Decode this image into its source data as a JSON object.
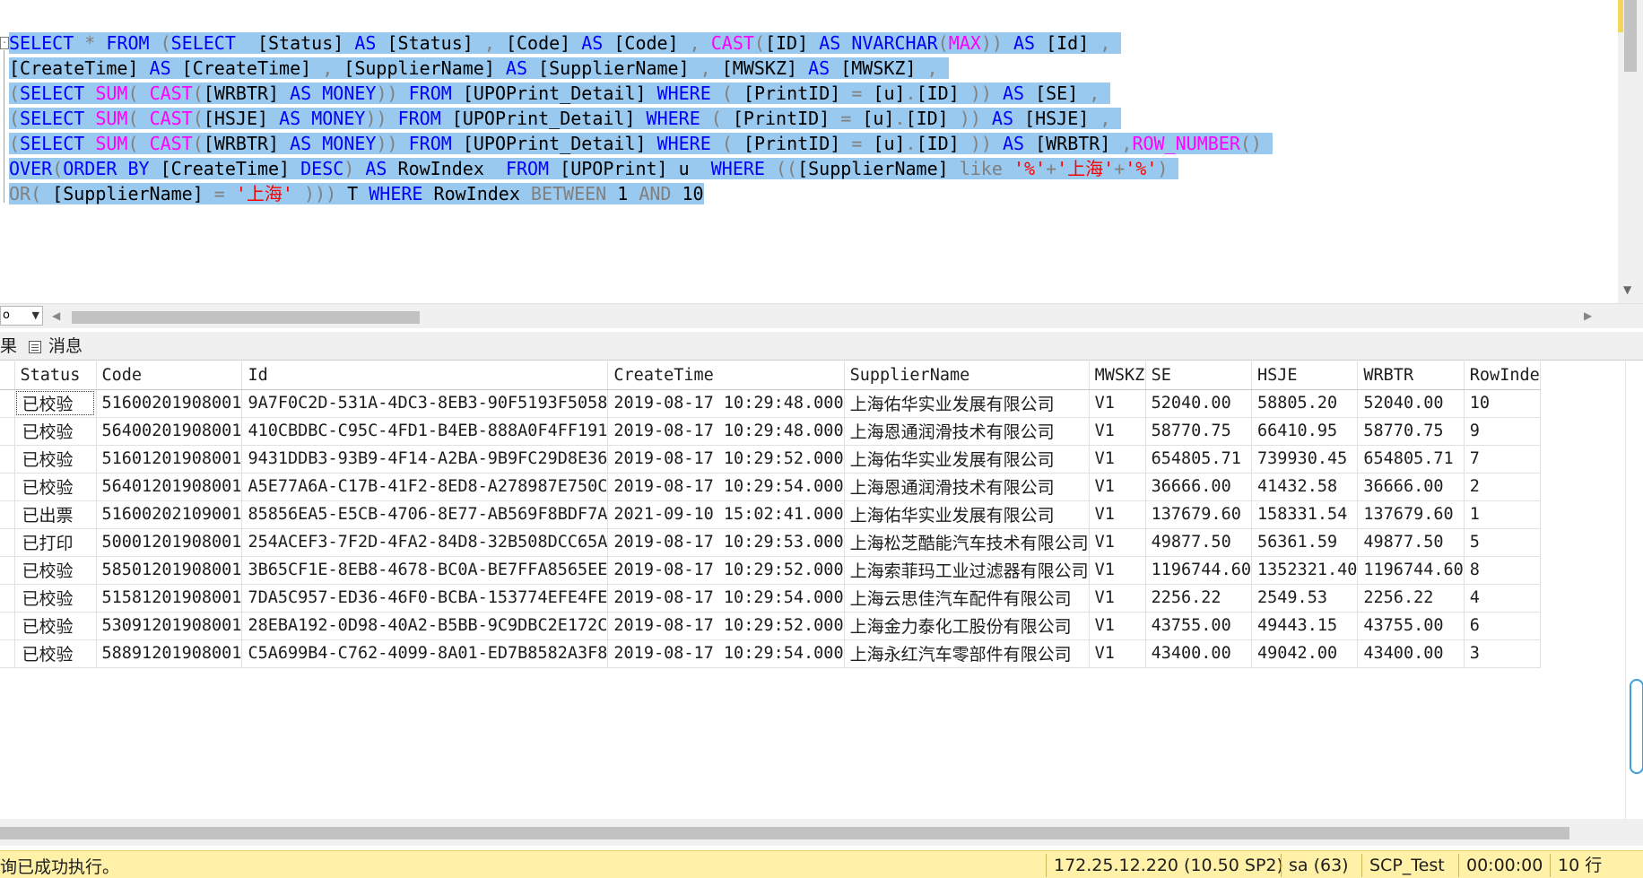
{
  "editor": {
    "fold_symbol": "-",
    "lines": [
      [
        [
          "kw",
          "SELECT"
        ],
        [
          "op",
          " * "
        ],
        [
          "kw",
          "FROM"
        ],
        [
          "tx",
          " "
        ],
        [
          "op",
          "("
        ],
        [
          "kw",
          "SELECT"
        ],
        [
          "tx",
          "  [Status] "
        ],
        [
          "kw",
          "AS"
        ],
        [
          "tx",
          " [Status] "
        ],
        [
          "op",
          ","
        ],
        [
          "tx",
          " [Code] "
        ],
        [
          "kw",
          "AS"
        ],
        [
          "tx",
          " [Code] "
        ],
        [
          "op",
          ","
        ],
        [
          "tx",
          " "
        ],
        [
          "fn",
          "CAST"
        ],
        [
          "op",
          "("
        ],
        [
          "tx",
          "[ID] "
        ],
        [
          "kw",
          "AS"
        ],
        [
          "tx",
          " "
        ],
        [
          "kw",
          "NVARCHAR"
        ],
        [
          "op",
          "("
        ],
        [
          "fn",
          "MAX"
        ],
        [
          "op",
          "))"
        ],
        [
          "tx",
          " "
        ],
        [
          "kw",
          "AS"
        ],
        [
          "tx",
          " [Id] "
        ],
        [
          "op",
          ","
        ],
        [
          "tx",
          " "
        ]
      ],
      [
        [
          "tx",
          "[CreateTime] "
        ],
        [
          "kw",
          "AS"
        ],
        [
          "tx",
          " [CreateTime] "
        ],
        [
          "op",
          ","
        ],
        [
          "tx",
          " [SupplierName] "
        ],
        [
          "kw",
          "AS"
        ],
        [
          "tx",
          " [SupplierName] "
        ],
        [
          "op",
          ","
        ],
        [
          "tx",
          " [MWSKZ] "
        ],
        [
          "kw",
          "AS"
        ],
        [
          "tx",
          " [MWSKZ] "
        ],
        [
          "op",
          ","
        ],
        [
          "tx",
          " "
        ]
      ],
      [
        [
          "op",
          "("
        ],
        [
          "kw",
          "SELECT"
        ],
        [
          "tx",
          " "
        ],
        [
          "fn",
          "SUM"
        ],
        [
          "op",
          "("
        ],
        [
          "tx",
          " "
        ],
        [
          "fn",
          "CAST"
        ],
        [
          "op",
          "("
        ],
        [
          "tx",
          "[WRBTR] "
        ],
        [
          "kw",
          "AS"
        ],
        [
          "tx",
          " "
        ],
        [
          "kw",
          "MONEY"
        ],
        [
          "op",
          "))"
        ],
        [
          "tx",
          " "
        ],
        [
          "kw",
          "FROM"
        ],
        [
          "tx",
          " [UPOPrint_Detail] "
        ],
        [
          "kw",
          "WHERE"
        ],
        [
          "tx",
          " "
        ],
        [
          "op",
          "("
        ],
        [
          "tx",
          " [PrintID] "
        ],
        [
          "op",
          "="
        ],
        [
          "tx",
          " [u]"
        ],
        [
          "op",
          "."
        ],
        [
          "tx",
          "[ID] "
        ],
        [
          "op",
          "))"
        ],
        [
          "tx",
          " "
        ],
        [
          "kw",
          "AS"
        ],
        [
          "tx",
          " [SE] "
        ],
        [
          "op",
          ","
        ],
        [
          "tx",
          " "
        ]
      ],
      [
        [
          "op",
          "("
        ],
        [
          "kw",
          "SELECT"
        ],
        [
          "tx",
          " "
        ],
        [
          "fn",
          "SUM"
        ],
        [
          "op",
          "("
        ],
        [
          "tx",
          " "
        ],
        [
          "fn",
          "CAST"
        ],
        [
          "op",
          "("
        ],
        [
          "tx",
          "[HSJE] "
        ],
        [
          "kw",
          "AS"
        ],
        [
          "tx",
          " "
        ],
        [
          "kw",
          "MONEY"
        ],
        [
          "op",
          "))"
        ],
        [
          "tx",
          " "
        ],
        [
          "kw",
          "FROM"
        ],
        [
          "tx",
          " [UPOPrint_Detail] "
        ],
        [
          "kw",
          "WHERE"
        ],
        [
          "tx",
          " "
        ],
        [
          "op",
          "("
        ],
        [
          "tx",
          " [PrintID] "
        ],
        [
          "op",
          "="
        ],
        [
          "tx",
          " [u]"
        ],
        [
          "op",
          "."
        ],
        [
          "tx",
          "[ID] "
        ],
        [
          "op",
          "))"
        ],
        [
          "tx",
          " "
        ],
        [
          "kw",
          "AS"
        ],
        [
          "tx",
          " [HSJE] "
        ],
        [
          "op",
          ","
        ],
        [
          "tx",
          " "
        ]
      ],
      [
        [
          "op",
          "("
        ],
        [
          "kw",
          "SELECT"
        ],
        [
          "tx",
          " "
        ],
        [
          "fn",
          "SUM"
        ],
        [
          "op",
          "("
        ],
        [
          "tx",
          " "
        ],
        [
          "fn",
          "CAST"
        ],
        [
          "op",
          "("
        ],
        [
          "tx",
          "[WRBTR] "
        ],
        [
          "kw",
          "AS"
        ],
        [
          "tx",
          " "
        ],
        [
          "kw",
          "MONEY"
        ],
        [
          "op",
          "))"
        ],
        [
          "tx",
          " "
        ],
        [
          "kw",
          "FROM"
        ],
        [
          "tx",
          " [UPOPrint_Detail] "
        ],
        [
          "kw",
          "WHERE"
        ],
        [
          "tx",
          " "
        ],
        [
          "op",
          "("
        ],
        [
          "tx",
          " [PrintID] "
        ],
        [
          "op",
          "="
        ],
        [
          "tx",
          " [u]"
        ],
        [
          "op",
          "."
        ],
        [
          "tx",
          "[ID] "
        ],
        [
          "op",
          "))"
        ],
        [
          "tx",
          " "
        ],
        [
          "kw",
          "AS"
        ],
        [
          "tx",
          " [WRBTR] "
        ],
        [
          "op",
          ","
        ],
        [
          "fn",
          "ROW_NUMBER"
        ],
        [
          "op",
          "()"
        ],
        [
          "tx",
          " "
        ]
      ],
      [
        [
          "kw",
          "OVER"
        ],
        [
          "op",
          "("
        ],
        [
          "kw",
          "ORDER BY"
        ],
        [
          "tx",
          " [CreateTime] "
        ],
        [
          "kw",
          "DESC"
        ],
        [
          "op",
          ")"
        ],
        [
          "tx",
          " "
        ],
        [
          "kw",
          "AS"
        ],
        [
          "tx",
          " RowIndex  "
        ],
        [
          "kw",
          "FROM"
        ],
        [
          "tx",
          " [UPOPrint] u  "
        ],
        [
          "kw",
          "WHERE"
        ],
        [
          "tx",
          " "
        ],
        [
          "op",
          "(("
        ],
        [
          "tx",
          "[SupplierName] "
        ],
        [
          "op",
          "like"
        ],
        [
          "tx",
          " "
        ],
        [
          "str",
          "'%'"
        ],
        [
          "op",
          "+"
        ],
        [
          "str",
          "'上海'"
        ],
        [
          "op",
          "+"
        ],
        [
          "str",
          "'%'"
        ],
        [
          "op",
          ")"
        ],
        [
          "tx",
          " "
        ]
      ],
      [
        [
          "op",
          "OR("
        ],
        [
          "tx",
          " [SupplierName] "
        ],
        [
          "op",
          "="
        ],
        [
          "tx",
          " "
        ],
        [
          "str",
          "'上海'"
        ],
        [
          "tx",
          " "
        ],
        [
          "op",
          ")))"
        ],
        [
          "tx",
          " T "
        ],
        [
          "kw",
          "WHERE"
        ],
        [
          "tx",
          " RowIndex "
        ],
        [
          "op",
          "BETWEEN"
        ],
        [
          "tx",
          " 1 "
        ],
        [
          "op",
          "AND"
        ],
        [
          "tx",
          " 10"
        ]
      ]
    ]
  },
  "zoom": {
    "value": "o"
  },
  "tabs": {
    "results": "果",
    "messages": "消息"
  },
  "grid": {
    "columns": [
      "Status",
      "Code",
      "Id",
      "CreateTime",
      "SupplierName",
      "MWSKZ",
      "SE",
      "HSJE",
      "WRBTR",
      "RowInde"
    ],
    "rows": [
      [
        "已校验",
        "51600201908001",
        "9A7F0C2D-531A-4DC3-8EB3-90F5193F5058",
        "2019-08-17 10:29:48.000",
        "上海佑华实业发展有限公司",
        "V1",
        "52040.00",
        "58805.20",
        "52040.00",
        "10"
      ],
      [
        "已校验",
        "56400201908001",
        "410CBDBC-C95C-4FD1-B4EB-888A0F4FF191",
        "2019-08-17 10:29:48.000",
        "上海恩通润滑技术有限公司",
        "V1",
        "58770.75",
        "66410.95",
        "58770.75",
        "9"
      ],
      [
        "已校验",
        "51601201908001",
        "9431DDB3-93B9-4F14-A2BA-9B9FC29D8E36",
        "2019-08-17 10:29:52.000",
        "上海佑华实业发展有限公司",
        "V1",
        "654805.71",
        "739930.45",
        "654805.71",
        "7"
      ],
      [
        "已校验",
        "56401201908001",
        "A5E77A6A-C17B-41F2-8ED8-A278987E750C",
        "2019-08-17 10:29:54.000",
        "上海恩通润滑技术有限公司",
        "V1",
        "36666.00",
        "41432.58",
        "36666.00",
        "2"
      ],
      [
        "已出票",
        "51600202109001",
        "85856EA5-E5CB-4706-8E77-AB569F8BDF7A",
        "2021-09-10 15:02:41.000",
        "上海佑华实业发展有限公司",
        "V1",
        "137679.60",
        "158331.54",
        "137679.60",
        "1"
      ],
      [
        "已打印",
        "50001201908001",
        "254ACEF3-7F2D-4FA2-84D8-32B508DCC65A",
        "2019-08-17 10:29:53.000",
        "上海松芝酷能汽车技术有限公司",
        "V1",
        "49877.50",
        "56361.59",
        "49877.50",
        "5"
      ],
      [
        "已校验",
        "58501201908001",
        "3B65CF1E-8EB8-4678-BC0A-BE7FFA8565EE",
        "2019-08-17 10:29:52.000",
        "上海索菲玛工业过滤器有限公司",
        "V1",
        "1196744.60",
        "1352321.40",
        "1196744.60",
        "8"
      ],
      [
        "已校验",
        "51581201908001",
        "7DA5C957-ED36-46F0-BCBA-153774EFE4FE",
        "2019-08-17 10:29:54.000",
        "上海云思佳汽车配件有限公司",
        "V1",
        "2256.22",
        "2549.53",
        "2256.22",
        "4"
      ],
      [
        "已校验",
        "53091201908001",
        "28EBA192-0D98-40A2-B5BB-9C9DBC2E172C",
        "2019-08-17 10:29:52.000",
        "上海金力泰化工股份有限公司",
        "V1",
        "43755.00",
        "49443.15",
        "43755.00",
        "6"
      ],
      [
        "已校验",
        "58891201908001",
        "C5A699B4-C762-4099-8A01-ED7B8582A3F8",
        "2019-08-17 10:29:54.000",
        "上海永红汽车零部件有限公司",
        "V1",
        "43400.00",
        "49042.00",
        "43400.00",
        "3"
      ]
    ]
  },
  "statusbar": {
    "message": "询已成功执行。",
    "server": "172.25.12.220 (10.50 SP2)",
    "user": "sa (63)",
    "database": "SCP_Test",
    "elapsed": "00:00:00",
    "rowcount": "10 行"
  }
}
